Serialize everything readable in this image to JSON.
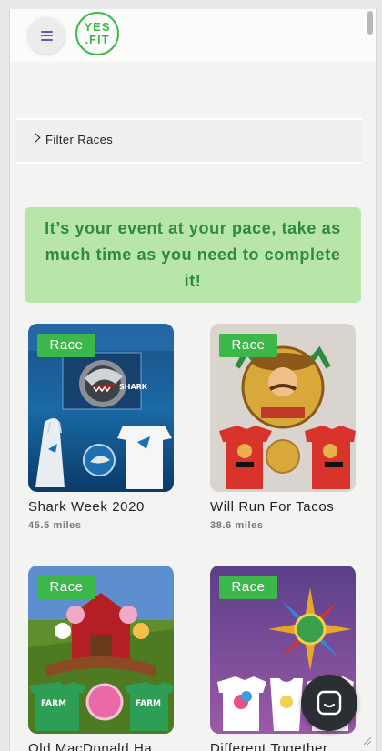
{
  "header": {
    "logo_line1": "YES",
    "logo_line2": ".FIT",
    "brand_color": "#3cb84a",
    "menu_icon_color": "#6b53b8"
  },
  "filter": {
    "label": "Filter Races"
  },
  "banner": {
    "text": "It’s your event at your pace, take as much time as you need to complete it!"
  },
  "cards": [
    {
      "badge": "Race",
      "title": "Shark Week 2020",
      "distance": "45.5 miles"
    },
    {
      "badge": "Race",
      "title": "Will Run For Tacos",
      "distance": "38.6 miles"
    },
    {
      "badge": "Race",
      "title": "Old MacDonald Ha"
    },
    {
      "badge": "Race",
      "title": "Different Together"
    }
  ],
  "chat": {
    "icon": "chat-icon"
  }
}
